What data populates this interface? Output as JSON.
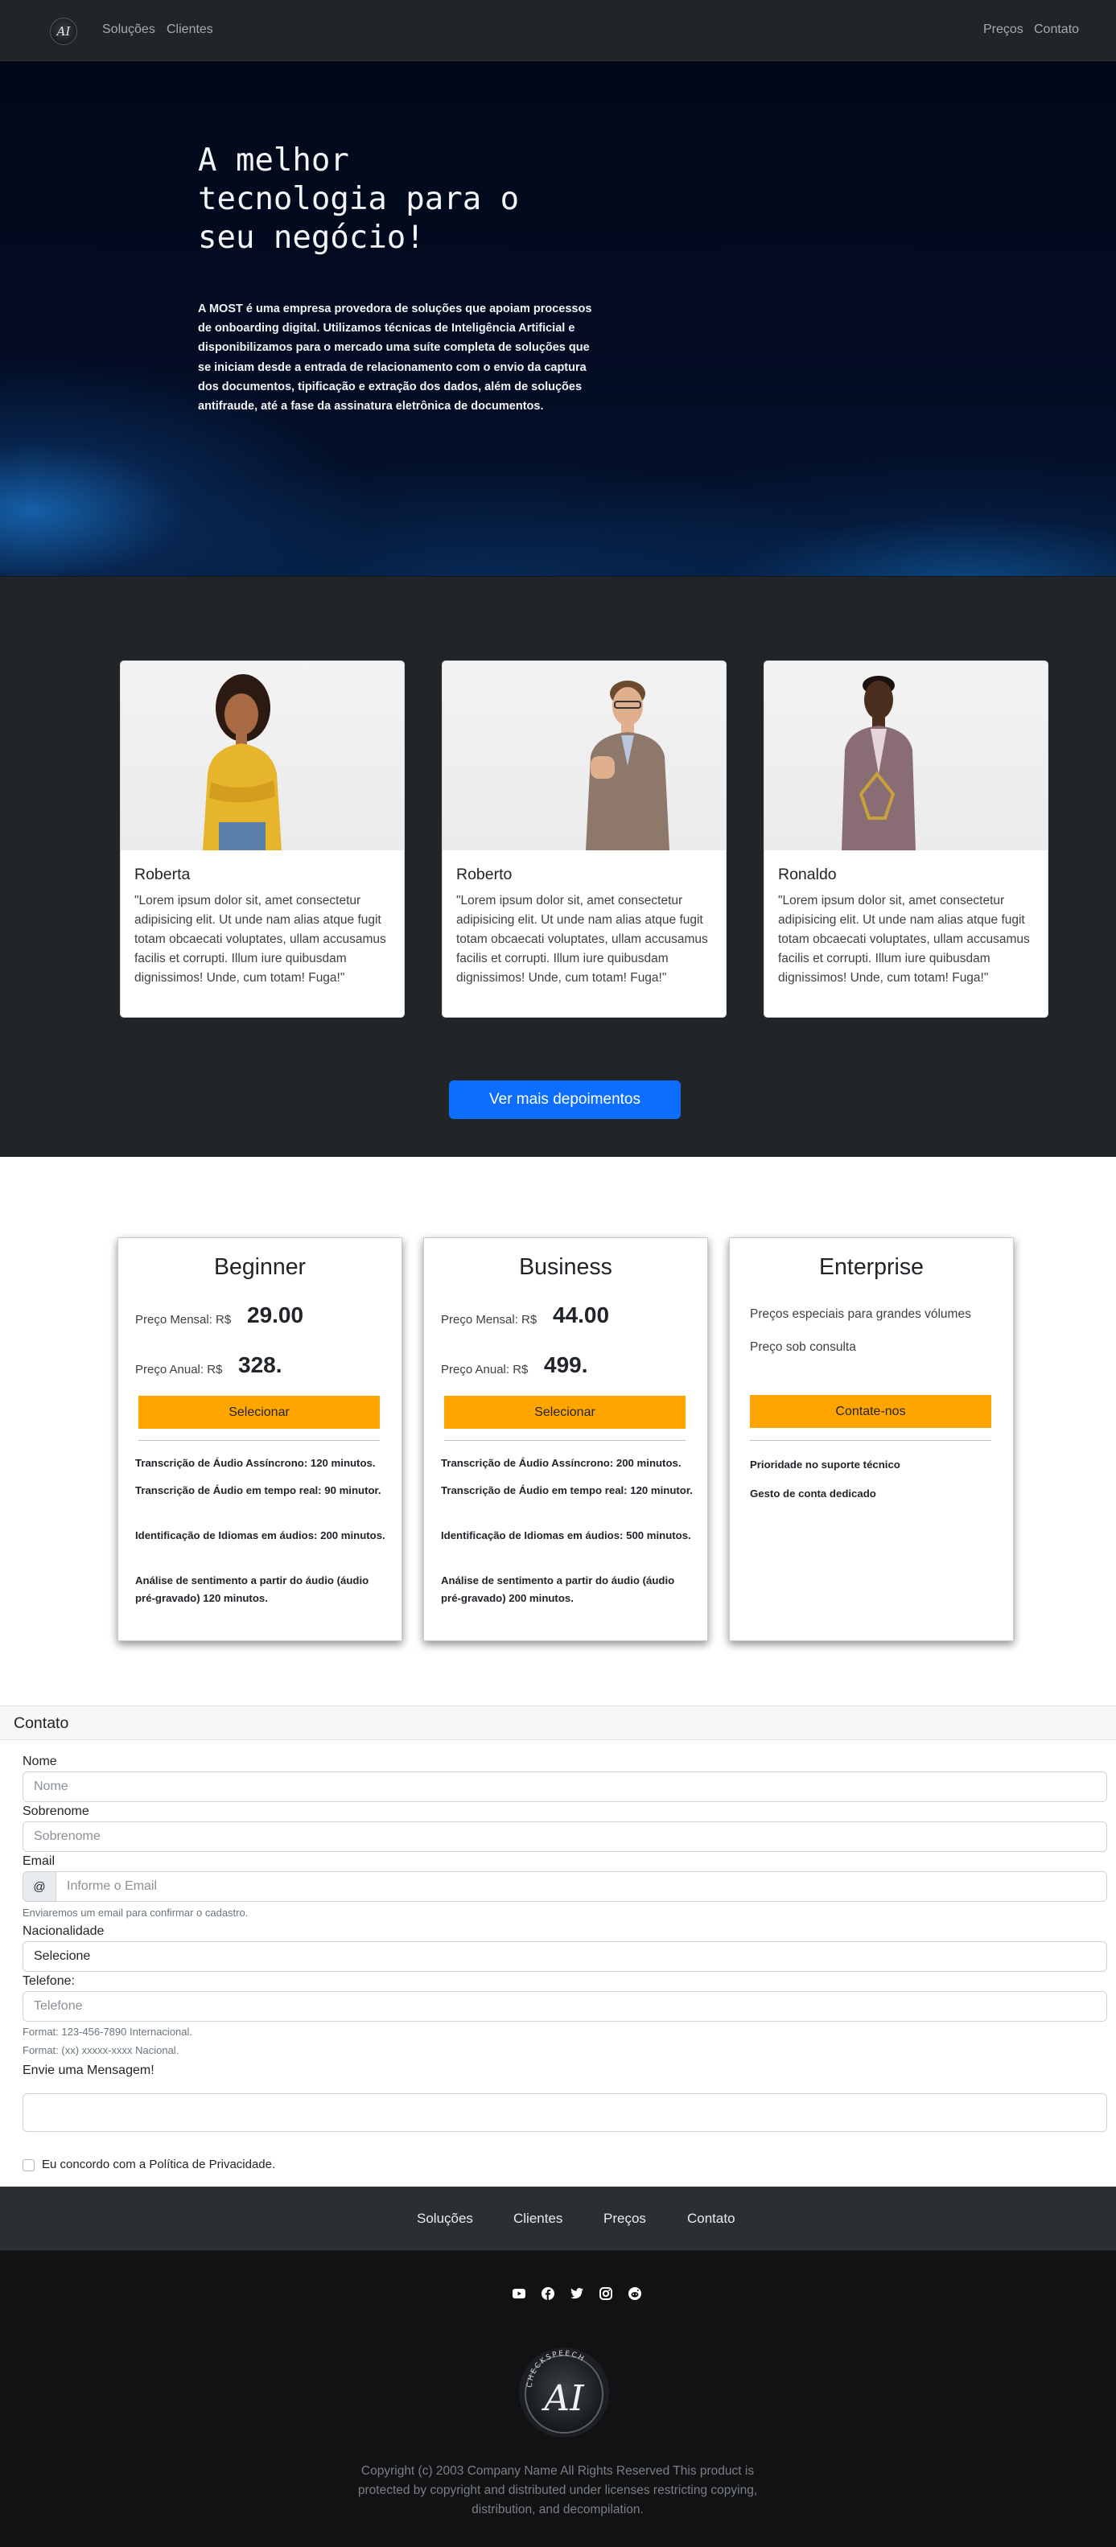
{
  "nav": {
    "brand_icon": "ai-logo-icon",
    "links_left": [
      "Soluções",
      "Clientes"
    ],
    "links_right": [
      "Preços",
      "Contato"
    ]
  },
  "hero": {
    "title": "A melhor tecnologia para o seu negócio!",
    "text": "A MOST é uma empresa provedora de soluções que apoiam processos de onboarding digital. Utilizamos técnicas de Inteligência Artificial e disponibilizamos para o mercado uma suíte completa de soluções que se iniciam desde a entrada de relacionamento com o envio da captura dos documentos, tipificação e extração dos dados, além de soluções antifraude, até a fase da assinatura eletrônica de documentos."
  },
  "testimonials": {
    "cards": [
      {
        "name": "Roberta",
        "quote": "\"Lorem ipsum dolor sit, amet consectetur adipisicing elit. Ut unde nam alias atque fugit totam obcaecati voluptates, ullam accusamus facilis et corrupti. Illum iure quibusdam dignissimos! Unde, cum totam! Fuga!\""
      },
      {
        "name": "Roberto",
        "quote": "\"Lorem ipsum dolor sit, amet consectetur adipisicing elit. Ut unde nam alias atque fugit totam obcaecati voluptates, ullam accusamus facilis et corrupti. Illum iure quibusdam dignissimos! Unde, cum totam! Fuga!\""
      },
      {
        "name": "Ronaldo",
        "quote": "\"Lorem ipsum dolor sit, amet consectetur adipisicing elit. Ut unde nam alias atque fugit totam obcaecati voluptates, ullam accusamus facilis et corrupti. Illum iure quibusdam dignissimos! Unde, cum totam! Fuga!\""
      }
    ],
    "more_button": "Ver mais depoimentos"
  },
  "pricing": {
    "plans": [
      {
        "title": "Beginner",
        "monthly_label": "Preço Mensal: R$",
        "monthly_value": "29.00",
        "annual_label": "Preço Anual: R$",
        "annual_value": "328.",
        "button": "Selecionar",
        "features": [
          "Transcrição de Áudio Assíncrono: 120 minutos.",
          "Transcrição de Áudio em tempo real: 90 minutor.",
          "Identificação de Idiomas em áudios: 200 minutos.",
          "Análise de sentimento a partir do áudio (áudio pré-gravado) 120 minutos."
        ]
      },
      {
        "title": "Business",
        "monthly_label": "Preço Mensal: R$",
        "monthly_value": "44.00",
        "annual_label": "Preço Anual: R$",
        "annual_value": "499.",
        "button": "Selecionar",
        "features": [
          "Transcrição de Áudio Assíncrono: 200 minutos.",
          "Transcrição de Áudio em tempo real: 120 minutor.",
          "Identificação de Idiomas em áudios: 500 minutos.",
          "Análise de sentimento a partir do áudio (áudio pré-gravado) 200 minutos."
        ]
      },
      {
        "title": "Enterprise",
        "line1": "Preços especiais para grandes vólumes",
        "line2": "Preço sob consulta",
        "button": "Contate-nos",
        "features": [
          "Prioridade no suporte técnico",
          "Gesto de conta dedicado"
        ]
      }
    ]
  },
  "contact": {
    "title": "Contato",
    "fields": {
      "first_name": {
        "label": "Nome",
        "placeholder": "Nome"
      },
      "last_name": {
        "label": "Sobrenome",
        "placeholder": "Sobrenome"
      },
      "email": {
        "label": "Email",
        "prefix": "@",
        "placeholder": "Informe o Email",
        "help": "Enviaremos um email para confirmar o cadastro."
      },
      "nationality": {
        "label": "Nacionalidade",
        "value": "Selecione"
      },
      "phone": {
        "label": "Telefone:",
        "placeholder": "Telefone",
        "help1": "Format: 123-456-7890 Internacional.",
        "help2": "Format: (xx) xxxxx-xxxx Nacional."
      },
      "message": {
        "label": "Envie uma Mensagem!"
      },
      "privacy": {
        "label": "Eu concordo com a Política de Privacidade."
      }
    }
  },
  "footer": {
    "links": [
      "Soluções",
      "Clientes",
      "Preços",
      "Contato"
    ],
    "social_icons": [
      "youtube-icon",
      "facebook-icon",
      "twitter-icon",
      "instagram-icon",
      "reddit-icon"
    ],
    "logo_text": "CHECKSPEECH",
    "logo_mark": "AI",
    "copyright": "Copyright (c) 2003 Company Name All Rights Reserved This product is protected by copyright and distributed under licenses restricting copying, distribution, and decompilation."
  },
  "colors": {
    "navbar": "#212529",
    "primary_button": "#0d6efd",
    "plan_button": "#ffa500",
    "footer": "#111213"
  }
}
